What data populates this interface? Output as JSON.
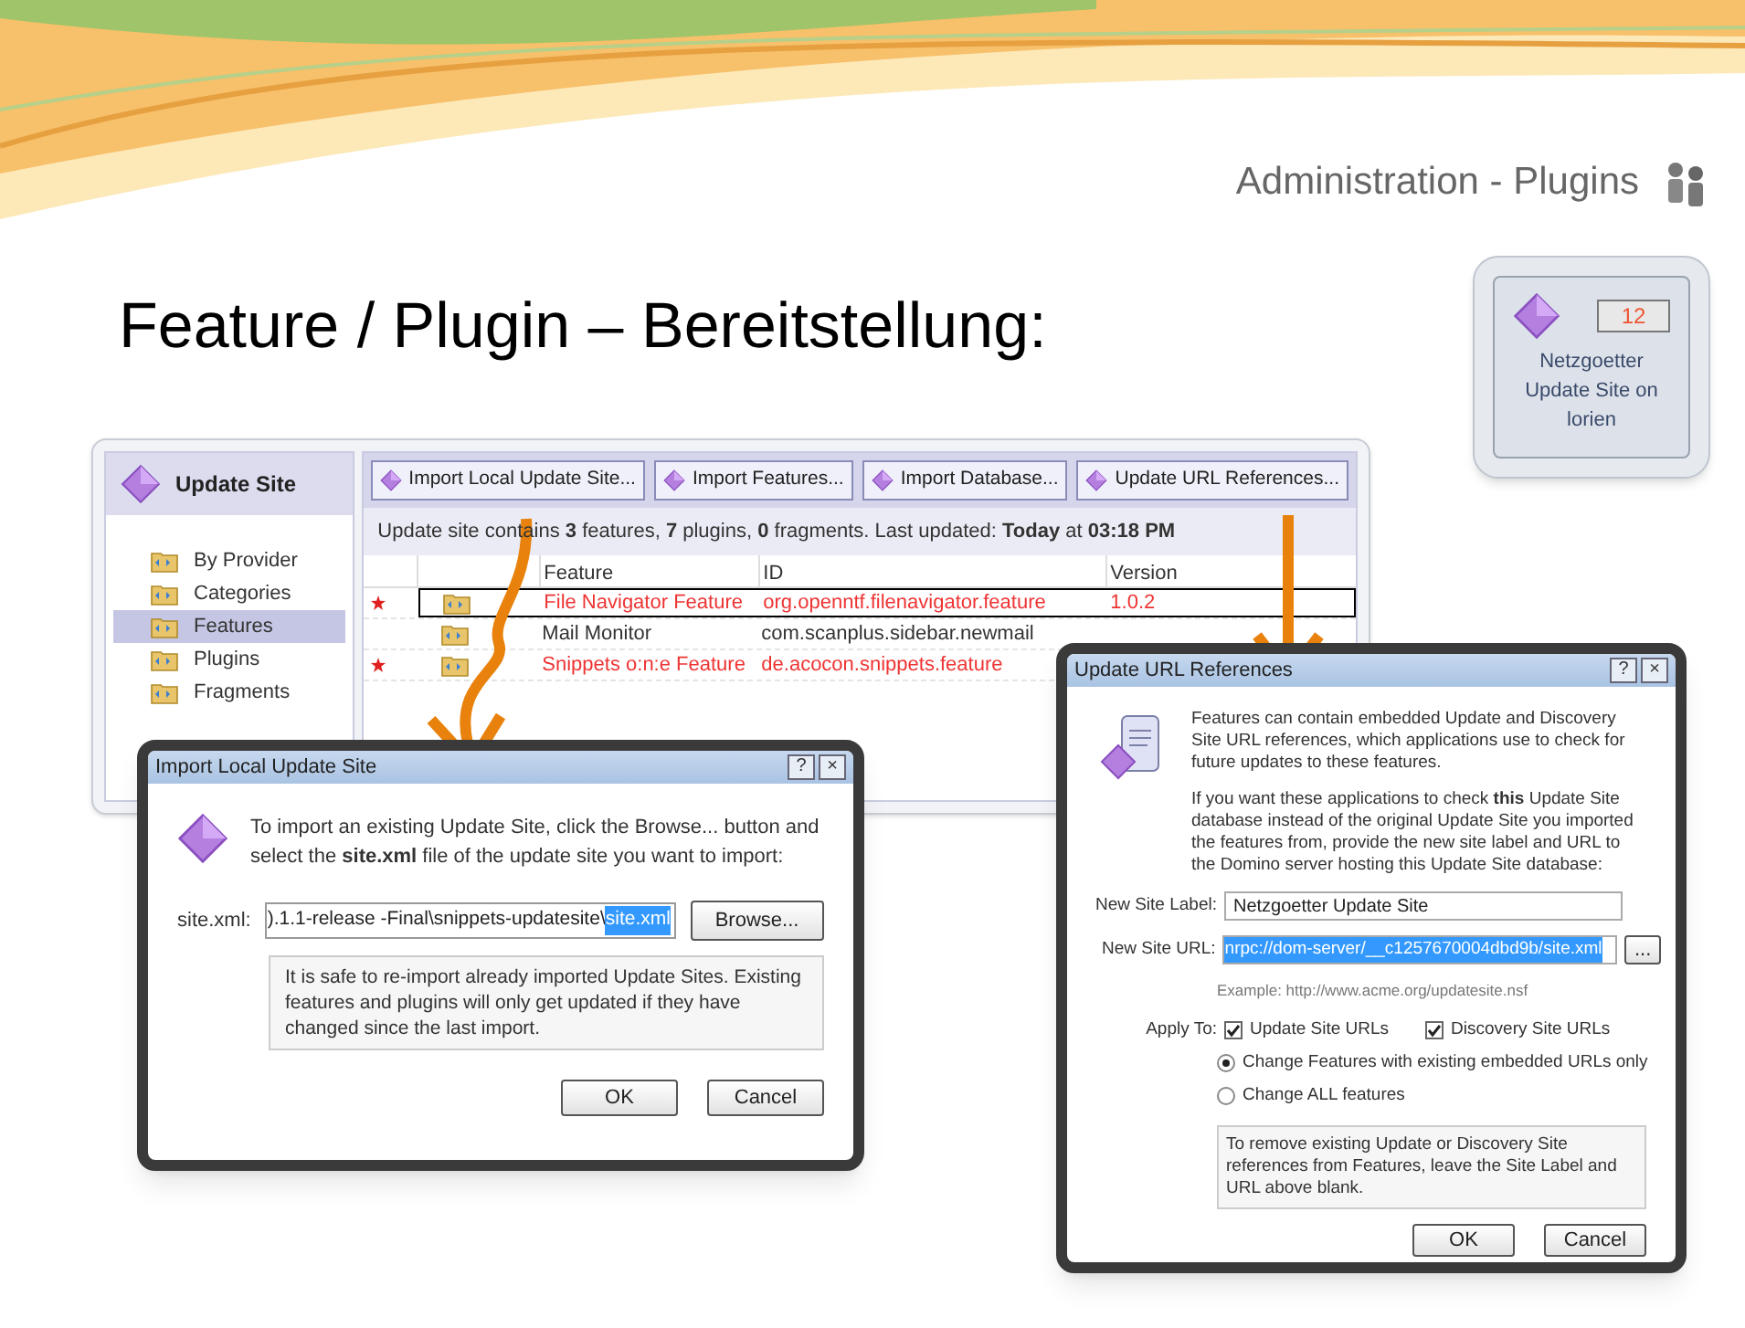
{
  "slide": {
    "section_title": "Administration - Plugins",
    "heading": "Feature / Plugin – Bereitstellung:"
  },
  "tile": {
    "count": "12",
    "label": "Netzgoetter Update Site on lorien"
  },
  "main_window": {
    "sidebar": {
      "title": "Update Site",
      "items": [
        {
          "label": "By Provider",
          "selected": false
        },
        {
          "label": "Categories",
          "selected": false
        },
        {
          "label": "Features",
          "selected": true
        },
        {
          "label": "Plugins",
          "selected": false
        },
        {
          "label": "Fragments",
          "selected": false
        }
      ]
    },
    "toolbar": [
      "Import Local Update Site...",
      "Import Features...",
      "Import Database...",
      "Update URL References..."
    ],
    "info": "Update site contains **3** features, **7** plugins, **0** fragments. Last updated: **Today** at **03:18 PM**",
    "table": {
      "columns": [
        "Feature",
        "ID",
        "Version"
      ],
      "rows": [
        {
          "new": true,
          "selected": true,
          "cells": [
            "File Navigator Feature",
            "org.openntf.filenavigator.feature",
            "1.0.2"
          ]
        },
        {
          "new": false,
          "selected": false,
          "cells": [
            "Mail Monitor",
            "com.scanplus.sidebar.newmail",
            ""
          ]
        },
        {
          "new": true,
          "selected": false,
          "cells": [
            "Snippets o:n:e Feature",
            "de.acocon.snippets.feature",
            ""
          ]
        }
      ]
    }
  },
  "import_dialog": {
    "title": "Import Local Update Site",
    "title_buttons": [
      "?",
      "×"
    ],
    "intro": "To import an existing Update Site, click the Browse... button and select the **site.xml** file of the update site you want to import:",
    "field_label": "site.xml:",
    "field_value": ").1.1-release -Final\\snippets-updatesite\\",
    "field_selected": "site.xml",
    "browse": "Browse...",
    "note": "It is safe to re-import already imported Update Sites. Existing features and plugins will only get updated if they have changed since the last import.",
    "buttons": [
      "OK",
      "Cancel"
    ]
  },
  "url_dialog": {
    "title": "Update URL References",
    "title_buttons": [
      "?",
      "×"
    ],
    "intro": "Features can contain embedded Update and Discovery Site URL references, which applications use to check for future updates to these features.",
    "intro2": "If you want these applications to check **this** Update Site database instead of the original Update Site you imported the features from, provide the new site label and URL to the Domino server hosting this Update Site database:",
    "label_label": "New Site Label:",
    "label_value": "Netzgoetter Update Site",
    "url_label": "New Site URL:",
    "url_value": "nrpc://dom-server/__c1257670004dbd9b/site.xml",
    "url_button": "...",
    "example": "Example: http://www.acme.org/updatesite.nsf",
    "apply_label": "Apply To:",
    "checkboxes": [
      {
        "label": "Update Site URLs",
        "checked": true
      },
      {
        "label": "Discovery Site URLs",
        "checked": true
      }
    ],
    "radios": [
      {
        "label": "Change Features with existing embedded URLs only",
        "selected": true
      },
      {
        "label": "Change ALL features",
        "selected": false
      }
    ],
    "note": "To remove existing Update or Discovery Site references from Features, leave the Site Label and URL above blank.",
    "buttons": [
      "OK",
      "Cancel"
    ]
  }
}
